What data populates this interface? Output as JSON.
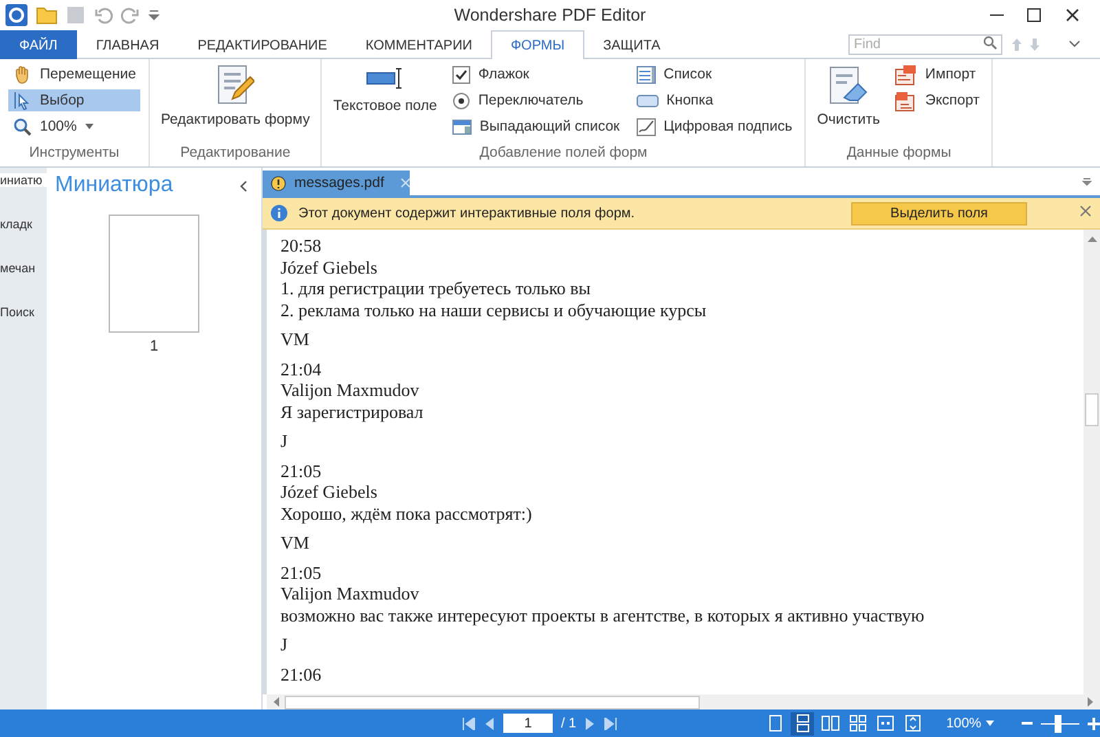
{
  "window": {
    "title": "Wondershare PDF Editor"
  },
  "tabs": [
    {
      "label": "ФАЙЛ",
      "kind": "file",
      "selected": false
    },
    {
      "label": "ГЛАВНАЯ",
      "kind": "tab",
      "selected": false
    },
    {
      "label": "РЕДАКТИРОВАНИЕ",
      "kind": "tab",
      "selected": false
    },
    {
      "label": "КОММЕНТАРИИ",
      "kind": "tab",
      "selected": false
    },
    {
      "label": "ФОРМЫ",
      "kind": "tab",
      "selected": true
    },
    {
      "label": "ЗАЩИТА",
      "kind": "tab",
      "selected": false
    }
  ],
  "search": {
    "placeholder": "Find"
  },
  "ribbon": {
    "groups": [
      {
        "title": "Инструменты",
        "items": [
          {
            "label": "Перемещение",
            "kind": "tool",
            "selected": false
          },
          {
            "label": "Выбор",
            "kind": "tool",
            "selected": true
          },
          {
            "label": "100%",
            "kind": "dropdown"
          }
        ]
      },
      {
        "title": "Редактирование",
        "items": [
          {
            "label": "Редактировать форму",
            "kind": "large"
          }
        ]
      },
      {
        "title": "Добавление полей форм",
        "items": [
          {
            "label": "Текстовое поле",
            "kind": "large"
          },
          {
            "label": "Флажок",
            "kind": "small"
          },
          {
            "label": "Переключатель",
            "kind": "small"
          },
          {
            "label": "Выпадающий список",
            "kind": "small"
          },
          {
            "label": "Список",
            "kind": "small"
          },
          {
            "label": "Кнопка",
            "kind": "small"
          },
          {
            "label": "Цифровая подпись",
            "kind": "small"
          }
        ]
      },
      {
        "title": "Данные формы",
        "items": [
          {
            "label": "Очистить",
            "kind": "large"
          },
          {
            "label": "Импорт",
            "kind": "small"
          },
          {
            "label": "Экспорт",
            "kind": "small"
          }
        ]
      }
    ]
  },
  "nav_strip": {
    "items": [
      {
        "label": "иниатю",
        "selected": true
      },
      {
        "label": "кладк",
        "selected": false
      },
      {
        "label": "мечан",
        "selected": false
      },
      {
        "label": "Поиск",
        "selected": false
      }
    ]
  },
  "thumbnails": {
    "title": "Миниатюра",
    "pages": [
      "1"
    ]
  },
  "document_tab": {
    "label": "messages.pdf"
  },
  "info_bar": {
    "message": "Этот документ содержит интерактивные поля форм.",
    "button": "Выделить поля"
  },
  "document": {
    "blocks": [
      [
        "20:58",
        "Józef Giebels",
        "1. для регистрации требуетесь только вы",
        "2. реклама только на наши сервисы и обучающие курсы"
      ],
      [
        "VM"
      ],
      [
        "21:04",
        "Valijon Maxmudov",
        "Я зарегистрировал"
      ],
      [
        "J"
      ],
      [
        "21:05",
        "Józef Giebels",
        "Хорошо, ждём пока рассмотрят:)"
      ],
      [
        "VM"
      ],
      [
        "21:05",
        "Valijon Maxmudov",
        "возможно вас также интересуют проекты в агентстве, в которых я активно участвую"
      ],
      [
        "J"
      ],
      [
        "21:06"
      ]
    ]
  },
  "status_bar": {
    "page": "1",
    "page_count": "/ 1",
    "views": [
      {
        "selected": false
      },
      {
        "selected": true
      },
      {
        "selected": false
      },
      {
        "selected": false
      },
      {
        "selected": false
      },
      {
        "selected": false
      }
    ],
    "zoom": "100%",
    "zoom_slider": {
      "level": 0.45
    }
  }
}
